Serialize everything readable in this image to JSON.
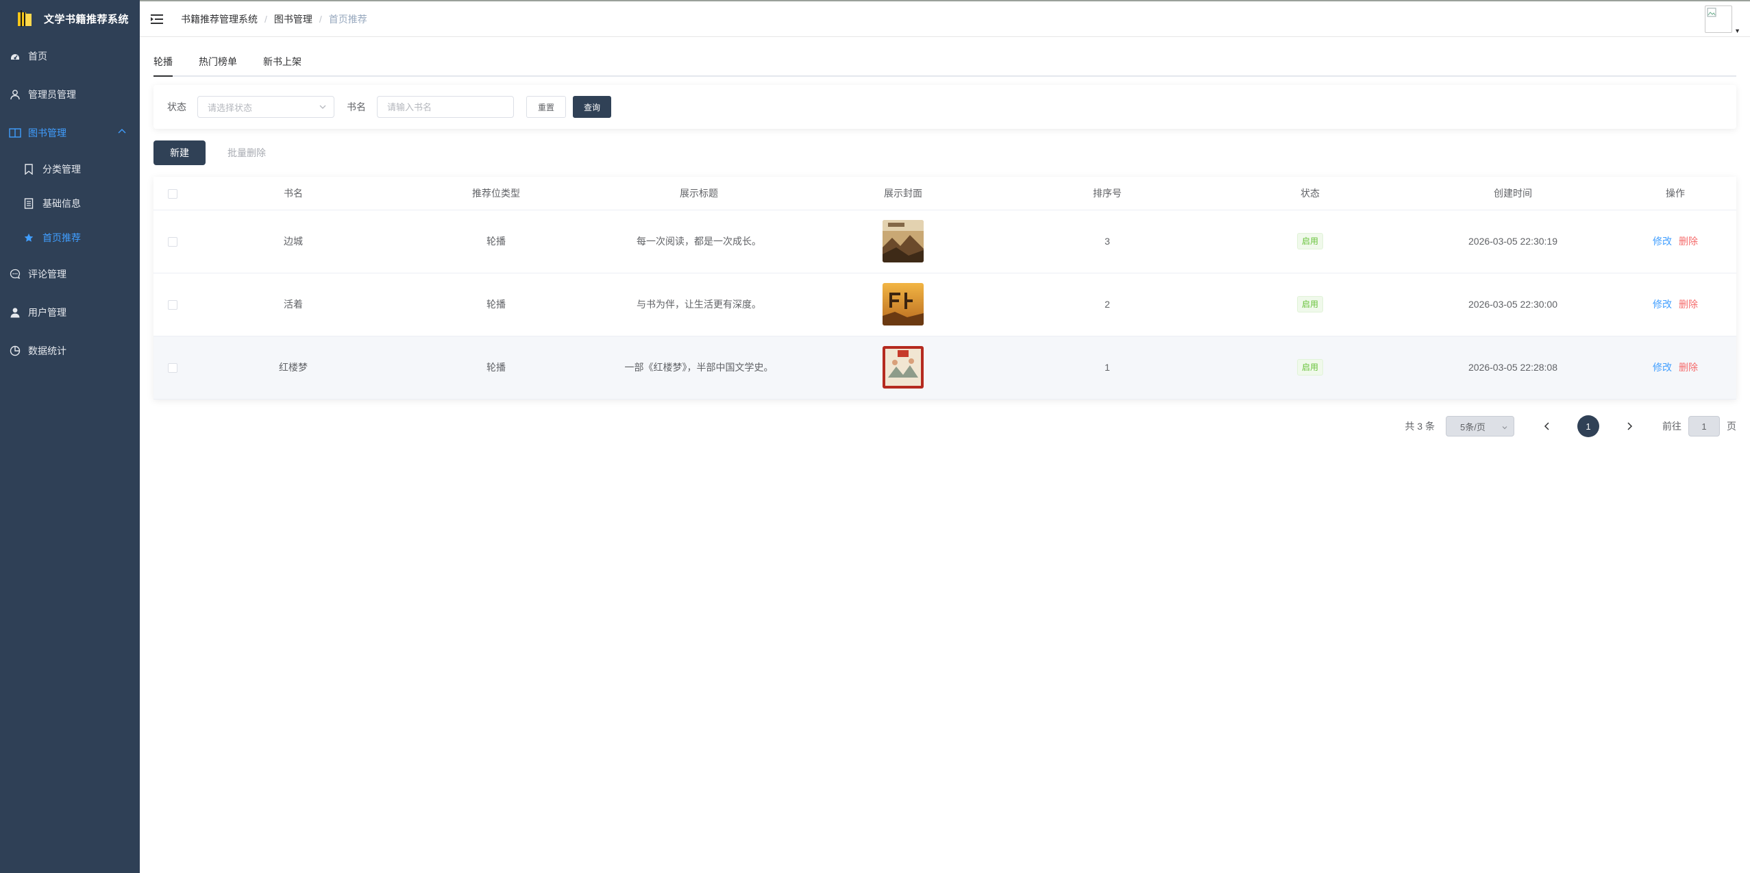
{
  "sidebar": {
    "title": "文学书籍推荐系统",
    "items": [
      {
        "label": "首页",
        "icon": "dashboard-icon"
      },
      {
        "label": "管理员管理",
        "icon": "user-outline-icon"
      },
      {
        "label": "图书管理",
        "icon": "book-open-icon",
        "expanded": true,
        "children": [
          {
            "label": "分类管理",
            "icon": "bookmark-icon"
          },
          {
            "label": "基础信息",
            "icon": "notebook-icon"
          },
          {
            "label": "首页推荐",
            "icon": "star-icon",
            "active": true
          }
        ]
      },
      {
        "label": "评论管理",
        "icon": "chat-bubble-icon"
      },
      {
        "label": "用户管理",
        "icon": "user-solid-icon"
      },
      {
        "label": "数据统计",
        "icon": "pie-chart-icon"
      }
    ]
  },
  "header": {
    "breadcrumb": [
      "书籍推荐管理系统",
      "图书管理",
      "首页推荐"
    ]
  },
  "tabs": [
    "轮播",
    "热门榜单",
    "新书上架"
  ],
  "filter": {
    "status_label": "状态",
    "status_placeholder": "请选择状态",
    "name_label": "书名",
    "name_placeholder": "请输入书名",
    "reset_label": "重置",
    "search_label": "查询"
  },
  "actions": {
    "new_label": "新建",
    "batch_delete_label": "批量删除"
  },
  "table": {
    "columns": [
      "书名",
      "推荐位类型",
      "展示标题",
      "展示封面",
      "排序号",
      "状态",
      "创建时间",
      "操作"
    ],
    "rows": [
      {
        "name": "边城",
        "type": "轮播",
        "title": "每一次阅读，都是一次成长。",
        "sort": "3",
        "status": "启用",
        "created": "2026-03-05 22:30:19",
        "edit": "修改",
        "delete": "删除"
      },
      {
        "name": "活着",
        "type": "轮播",
        "title": "与书为伴，让生活更有深度。",
        "sort": "2",
        "status": "启用",
        "created": "2026-03-05 22:30:00",
        "edit": "修改",
        "delete": "删除"
      },
      {
        "name": "红楼梦",
        "type": "轮播",
        "title": "一部《红楼梦》，半部中国文学史。",
        "sort": "1",
        "status": "启用",
        "created": "2026-03-05 22:28:08",
        "edit": "修改",
        "delete": "删除"
      }
    ]
  },
  "pagination": {
    "total_text": "共 3 条",
    "page_size": "5条/页",
    "current_page": "1",
    "goto_label": "前往",
    "goto_value": "1",
    "page_suffix": "页"
  },
  "colors": {
    "sidebar_bg": "#2f4056",
    "accent": "#409eff",
    "primary_button": "#304156",
    "enabled_tag": "#67c23a",
    "danger": "#f56c6c"
  }
}
